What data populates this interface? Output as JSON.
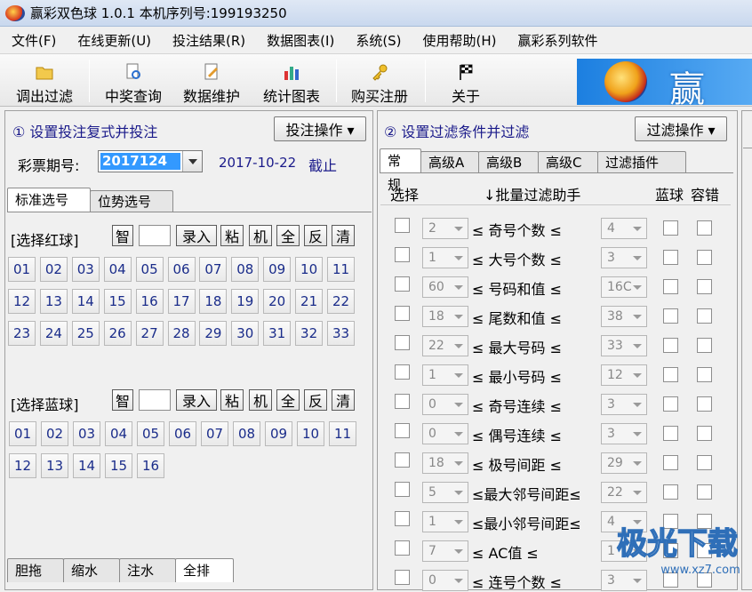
{
  "window": {
    "title": "赢彩双色球 1.0.1  本机序列号:199193250"
  },
  "menu": [
    "文件(F)",
    "在线更新(U)",
    "投注结果(R)",
    "数据图表(I)",
    "系统(S)",
    "使用帮助(H)",
    "赢彩系列软件"
  ],
  "toolbar": {
    "items": [
      {
        "label": "调出过滤",
        "icon": "folder-icon"
      },
      {
        "label": "中奖查询",
        "icon": "document-search-icon"
      },
      {
        "label": "数据维护",
        "icon": "edit-document-icon"
      },
      {
        "label": "统计图表",
        "icon": "bar-chart-icon"
      },
      {
        "label": "购买注册",
        "icon": "key-icon"
      },
      {
        "label": "关于",
        "icon": "flag-icon"
      }
    ],
    "banner": "赢彩"
  },
  "left": {
    "title": "① 设置投注复式并投注",
    "action_button": "投注操作 ▾",
    "issue_label": "彩票期号:",
    "issue_value": "2017124",
    "date": "2017-10-22",
    "deadline": "截止",
    "tabs": [
      "标准选号",
      "位势选号"
    ],
    "red_label": "[选择红球]",
    "blue_label": "[选择蓝球]",
    "controls": [
      "智",
      "录入",
      "粘",
      "机",
      "全",
      "反",
      "清"
    ],
    "red_balls": [
      "01",
      "02",
      "03",
      "04",
      "05",
      "06",
      "07",
      "08",
      "09",
      "10",
      "11",
      "12",
      "13",
      "14",
      "15",
      "16",
      "17",
      "18",
      "19",
      "20",
      "21",
      "22",
      "23",
      "24",
      "25",
      "26",
      "27",
      "28",
      "29",
      "30",
      "31",
      "32",
      "33"
    ],
    "blue_balls": [
      "01",
      "02",
      "03",
      "04",
      "05",
      "06",
      "07",
      "08",
      "09",
      "10",
      "11",
      "12",
      "13",
      "14",
      "15",
      "16"
    ],
    "bottom_tabs": [
      "胆拖",
      "缩水",
      "注水",
      "全排"
    ]
  },
  "mid": {
    "title": "② 设置过滤条件并过滤",
    "action_button": "过滤操作 ▾",
    "tabs": [
      "常规",
      "高级A",
      "高级B",
      "高级C",
      "过滤插件"
    ],
    "col_select": "选择",
    "col_helper": "↓批量过滤助手",
    "col_blue": "蓝球",
    "col_tolerance": "容错",
    "rows": [
      {
        "min": "2",
        "label": "≤  奇号个数  ≤",
        "max": "4"
      },
      {
        "min": "1",
        "label": "≤  大号个数  ≤",
        "max": "3"
      },
      {
        "min": "60",
        "label": "≤  号码和值  ≤",
        "max": "16C"
      },
      {
        "min": "18",
        "label": "≤  尾数和值  ≤",
        "max": "38"
      },
      {
        "min": "22",
        "label": "≤  最大号码  ≤",
        "max": "33"
      },
      {
        "min": "1",
        "label": "≤  最小号码  ≤",
        "max": "12"
      },
      {
        "min": "0",
        "label": "≤  奇号连续  ≤",
        "max": "3"
      },
      {
        "min": "0",
        "label": "≤  偶号连续  ≤",
        "max": "3"
      },
      {
        "min": "18",
        "label": "≤  极号间距  ≤",
        "max": "29"
      },
      {
        "min": "5",
        "label": "≤最大邻号间距≤",
        "max": "22"
      },
      {
        "min": "1",
        "label": "≤最小邻号间距≤",
        "max": "4"
      },
      {
        "min": "7",
        "label": "≤    AC值    ≤",
        "max": "1"
      },
      {
        "min": "0",
        "label": "≤  连号个数  ≤",
        "max": "3"
      }
    ]
  },
  "watermark": {
    "text": "极光下载",
    "url": "www.xz7.com"
  }
}
